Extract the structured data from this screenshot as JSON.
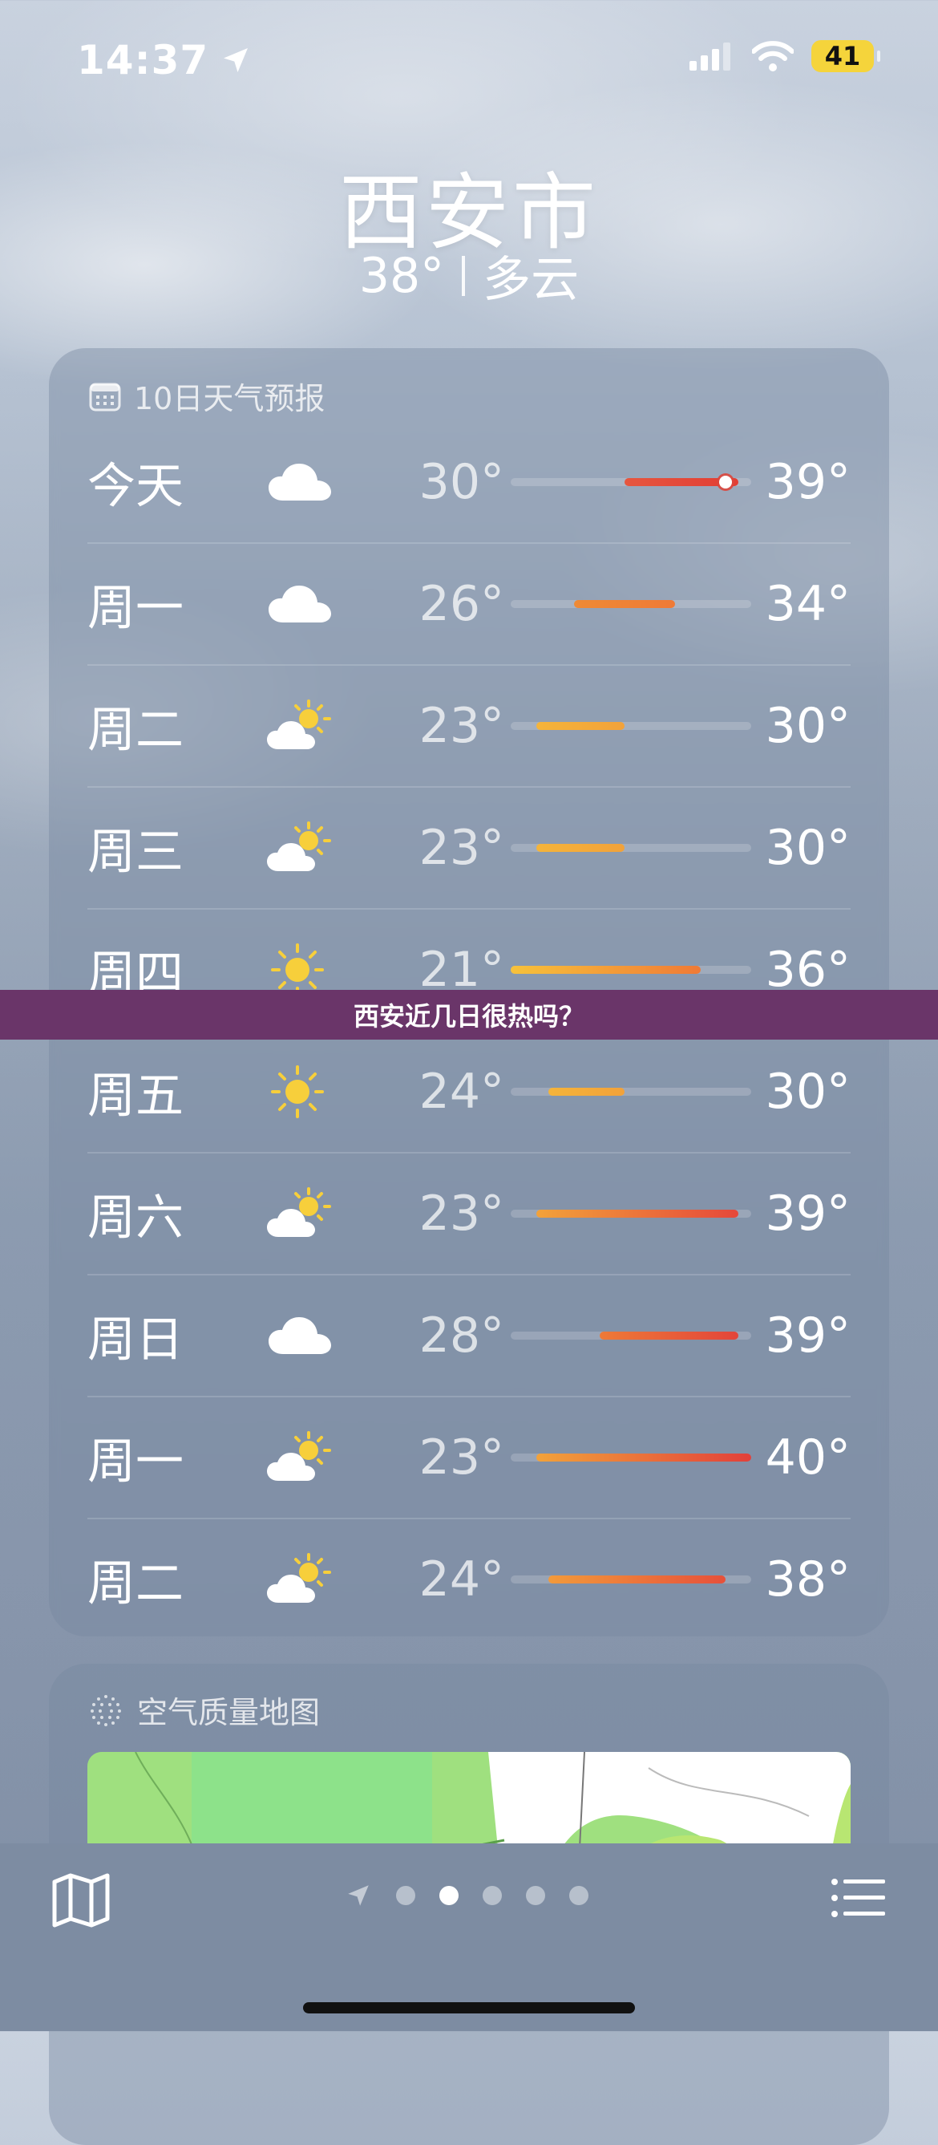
{
  "status_bar": {
    "time": "14:37",
    "battery": "41"
  },
  "header": {
    "city": "西安市",
    "current_temp": "38°",
    "condition": "多云"
  },
  "forecast": {
    "title": "10日天气预报",
    "scale": {
      "min": 21,
      "max": 40
    },
    "days": [
      {
        "day": "今天",
        "icon": "cloud-icon",
        "low": "30°",
        "high": "39°",
        "low_v": 30,
        "high_v": 39,
        "current": 38,
        "color": [
          "#e6563f",
          "#e23d34"
        ]
      },
      {
        "day": "周一",
        "icon": "cloud-icon",
        "low": "26°",
        "high": "34°",
        "low_v": 26,
        "high_v": 34,
        "color": [
          "#ef8a35",
          "#ef7a36"
        ]
      },
      {
        "day": "周二",
        "icon": "partly-sunny-icon",
        "low": "23°",
        "high": "30°",
        "low_v": 23,
        "high_v": 30,
        "color": [
          "#f5b43a",
          "#f2a23a"
        ]
      },
      {
        "day": "周三",
        "icon": "partly-sunny-icon",
        "low": "23°",
        "high": "30°",
        "low_v": 23,
        "high_v": 30,
        "color": [
          "#f5b43a",
          "#f2a23a"
        ]
      },
      {
        "day": "周四",
        "icon": "sun-icon",
        "low": "21°",
        "high": "36°",
        "low_v": 21,
        "high_v": 36,
        "color": [
          "#f7c23b",
          "#ef7a36"
        ]
      },
      {
        "day": "周五",
        "icon": "sun-icon",
        "low": "24°",
        "high": "30°",
        "low_v": 24,
        "high_v": 30,
        "color": [
          "#f5b43a",
          "#f2a23a"
        ]
      },
      {
        "day": "周六",
        "icon": "partly-sunny-icon",
        "low": "23°",
        "high": "39°",
        "low_v": 23,
        "high_v": 39,
        "color": [
          "#f2a23a",
          "#e6483a"
        ]
      },
      {
        "day": "周日",
        "icon": "cloud-icon",
        "low": "28°",
        "high": "39°",
        "low_v": 28,
        "high_v": 39,
        "color": [
          "#ee7a38",
          "#e2453a"
        ]
      },
      {
        "day": "周一",
        "icon": "partly-sunny-icon",
        "low": "23°",
        "high": "40°",
        "low_v": 23,
        "high_v": 40,
        "color": [
          "#f2a23a",
          "#e2403a"
        ]
      },
      {
        "day": "周二",
        "icon": "partly-sunny-icon",
        "low": "24°",
        "high": "38°",
        "low_v": 24,
        "high_v": 38,
        "color": [
          "#f29a3a",
          "#e6503a"
        ]
      }
    ]
  },
  "air_quality": {
    "title": "空气质量地图"
  },
  "banner": {
    "text": "西安近几日很热吗？"
  },
  "pager": {
    "pages": 5,
    "active": 1
  }
}
